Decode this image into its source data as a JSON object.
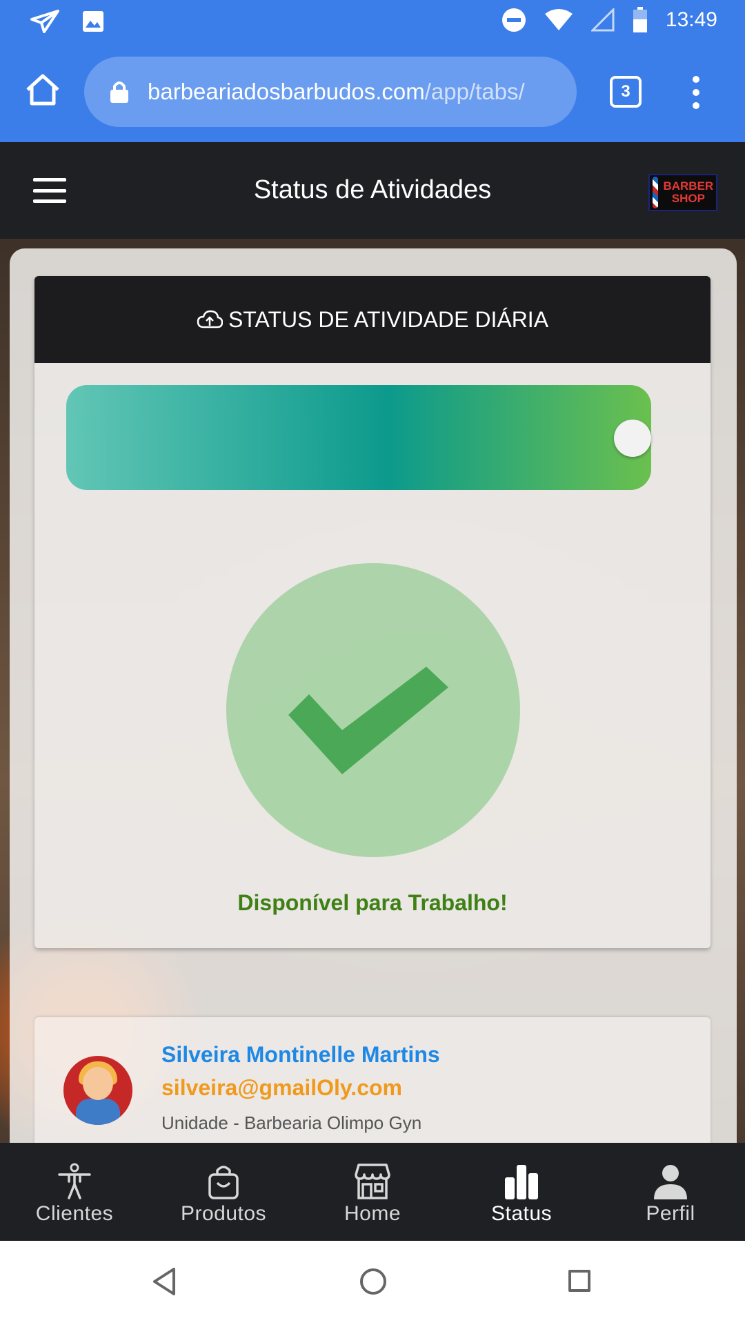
{
  "status_bar": {
    "time": "13:49"
  },
  "browser": {
    "url_host": "barbeariadosbarbudos.com",
    "url_path": "/app/tabs/",
    "tab_count": "3"
  },
  "header": {
    "title": "Status de Atividades",
    "logo_text": "BARBER SHOP"
  },
  "status_card": {
    "title": "STATUS DE ATIVIDADE DIÁRIA",
    "toggle_on": true,
    "message": "Disponível para Trabalho!"
  },
  "profile": {
    "name": "Silveira Montinelle Martins",
    "email": "silveira@gmailOly.com",
    "unit": "Unidade - Barbearia Olimpo Gyn"
  },
  "tabs": [
    {
      "label": "Clientes",
      "icon": "accessibility-icon",
      "active": false
    },
    {
      "label": "Produtos",
      "icon": "shopping-bag-icon",
      "active": false
    },
    {
      "label": "Home",
      "icon": "storefront-icon",
      "active": false
    },
    {
      "label": "Status",
      "icon": "bar-chart-icon",
      "active": true
    },
    {
      "label": "Perfil",
      "icon": "person-icon",
      "active": false
    }
  ],
  "colors": {
    "chrome_blue": "#3b7de9",
    "header_dark": "#1f2024",
    "available_green": "#3f8015",
    "name_blue": "#1e88e5",
    "email_orange": "#f09a1d"
  }
}
